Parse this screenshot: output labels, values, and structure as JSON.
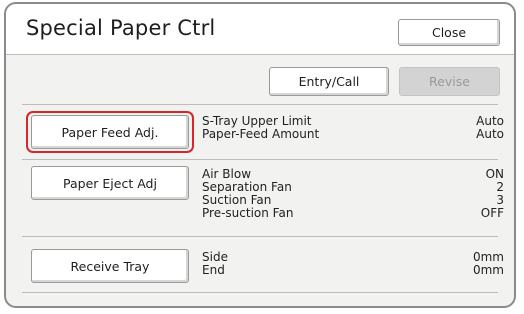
{
  "title": "Special Paper Ctrl",
  "close_label": "Close",
  "entry_call_label": "Entry/Call",
  "revise_label": "Revise",
  "sections": [
    {
      "button": "Paper Feed Adj.",
      "items": [
        {
          "label": "S-Tray Upper Limit",
          "value": "Auto"
        },
        {
          "label": "Paper-Feed Amount",
          "value": "Auto"
        }
      ]
    },
    {
      "button": "Paper Eject Adj",
      "items": [
        {
          "label": "Air Blow",
          "value": "ON"
        },
        {
          "label": "Separation Fan",
          "value": "2"
        },
        {
          "label": "Suction Fan",
          "value": "3"
        },
        {
          "label": "Pre-suction Fan",
          "value": "OFF"
        }
      ]
    },
    {
      "button": "Receive Tray",
      "items": [
        {
          "label": "Side",
          "value": "0mm"
        },
        {
          "label": "End",
          "value": "0mm"
        }
      ]
    }
  ],
  "selected_highlight_color": "#d8262b"
}
